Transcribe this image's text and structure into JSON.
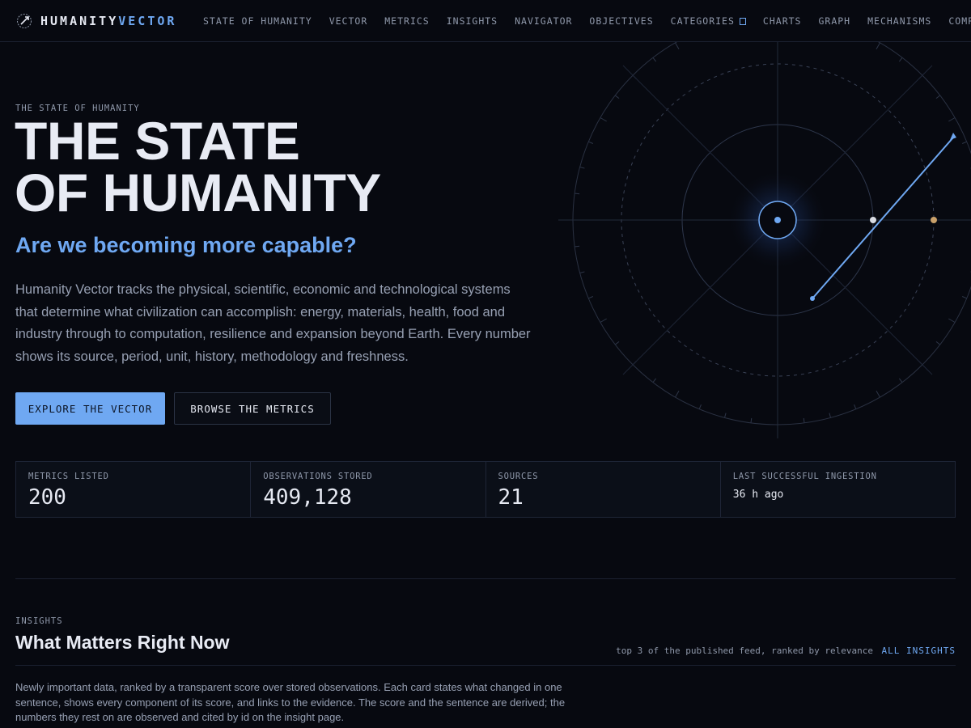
{
  "nav": {
    "logo_primary": "HUMANITY",
    "logo_accent": "VECTOR",
    "items": [
      {
        "label": "STATE OF HUMANITY"
      },
      {
        "label": "VECTOR"
      },
      {
        "label": "METRICS"
      },
      {
        "label": "INSIGHTS"
      },
      {
        "label": "NAVIGATOR"
      },
      {
        "label": "OBJECTIVES"
      },
      {
        "label": "CATEGORIES"
      },
      {
        "label": "CHARTS"
      },
      {
        "label": "GRAPH"
      },
      {
        "label": "MECHANISMS"
      },
      {
        "label": "COMPA"
      }
    ]
  },
  "hero": {
    "eyebrow": "THE STATE OF HUMANITY",
    "title_line1": "THE STATE",
    "title_line2": "OF HUMANITY",
    "subtitle": "Are we becoming more capable?",
    "body": "Humanity Vector tracks the physical, scientific, economic and technological systems that determine what civilization can accomplish: energy, materials, health, food and industry through to computation, resilience and expansion beyond Earth. Every number shows its source, period, unit, history, methodology and freshness.",
    "primary_button": "EXPLORE THE VECTOR",
    "secondary_button": "BROWSE THE METRICS"
  },
  "stats": [
    {
      "label": "METRICS LISTED",
      "value": "200"
    },
    {
      "label": "OBSERVATIONS STORED",
      "value": "409,128"
    },
    {
      "label": "SOURCES",
      "value": "21"
    },
    {
      "label": "LAST SUCCESSFUL INGESTION",
      "value": "36 h ago"
    }
  ],
  "insights": {
    "eyebrow": "INSIGHTS",
    "title": "What Matters Right Now",
    "meta": "top 3 of the published feed, ranked by relevance",
    "link": "ALL INSIGHTS",
    "body": "Newly important data, ranked by a transparent score over stored observations. Each card states what changed in one sentence, shows every component of its score, and links to the evidence. The score and the sentence are derived; the numbers they rest on are observed and cited by id on the insight page."
  },
  "colors": {
    "background": "#070910",
    "accent": "#6fa8f2",
    "muted": "#8f98aa",
    "marker_white": "#d9dce3",
    "marker_gold": "#c9a06a"
  }
}
